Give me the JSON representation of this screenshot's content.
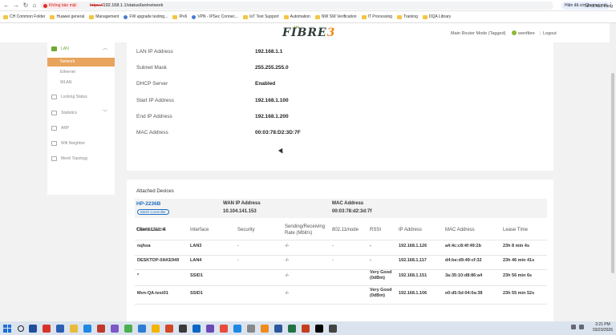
{
  "browser": {
    "security_label": "Không bảo mật",
    "url_scheme": "https://",
    "url_rest": "192.168.1.1/status/lan/network",
    "update_button": "Hiện đã có Chrome mới",
    "bookmarks": [
      {
        "label": "CH Common Folder",
        "icon": "folder"
      },
      {
        "label": "Huawei general",
        "icon": "folder"
      },
      {
        "label": "Management",
        "icon": "folder"
      },
      {
        "label": "FW upgrade testing...",
        "icon": "site"
      },
      {
        "label": "IPv6",
        "icon": "folder"
      },
      {
        "label": "VPN - IPSec Connec...",
        "icon": "site"
      },
      {
        "label": "IoT Test Support",
        "icon": "folder"
      },
      {
        "label": "Automation",
        "icon": "folder"
      },
      {
        "label": "NW SW Verification",
        "icon": "folder"
      },
      {
        "label": "IT Processing",
        "icon": "folder"
      },
      {
        "label": "Training",
        "icon": "folder"
      },
      {
        "label": "DQA Library",
        "icon": "folder"
      }
    ],
    "all_bookmarks": "Tất cả dấu trang"
  },
  "header": {
    "logo_prefix": "AIS",
    "logo_main": "FIBRE",
    "logo_digit": "3",
    "mode": "Main Router Mode (Tagged)",
    "user": "wenfibre",
    "separator": "|",
    "logout": "Logout"
  },
  "sidebar": {
    "lan": "LAN",
    "network": "Network",
    "ethernet": "Ethernet",
    "wlan": "WLAN",
    "locking": "Locking Status",
    "statistics": "Statistics",
    "arp": "ARP",
    "wifi_neighbor": "Wifi Neighbor",
    "mesh_topology": "Mesh Topology"
  },
  "lan_info": [
    {
      "label": "LAN IP Address",
      "value": "192.168.1.1"
    },
    {
      "label": "Subnet Mask",
      "value": "255.255.255.0"
    },
    {
      "label": "DHCP Server",
      "value": "Enabled"
    },
    {
      "label": "Start IP Address",
      "value": "192.168.1.100"
    },
    {
      "label": "End IP Address",
      "value": "192.168.1.200"
    },
    {
      "label": "MAC Address",
      "value": "00:03:78:D2:3D:7F"
    }
  ],
  "attached": {
    "title": "Attached Devices",
    "device_name": "HP-2236B",
    "badge": "Mesh Controller",
    "wan_label": "WAN IP Address",
    "wan_value": "10.104.141.153",
    "mac_label": "MAC Address",
    "mac_value": "00:03:78:d2:3d:7f",
    "client_list": "Client List: 4"
  },
  "table": {
    "headers": [
      "Device Name",
      "Interface",
      "Security",
      "Sending/Receiving Rate (Mbit/s)",
      "802.11mode",
      "RSSI",
      "IP Address",
      "MAC Address",
      "Lease Time"
    ],
    "rows": [
      [
        "nqhoa",
        "LAN3",
        "-",
        "-/-",
        "-",
        "-",
        "192.168.1.126",
        "a4:4c:c8:4f:49:2b",
        "23h 8 min 4s"
      ],
      [
        "DESKTOP-0AKE949",
        "LAN4",
        "-",
        "-/-",
        "-",
        "-",
        "192.168.1.117",
        "d4:be:d9:49:cf:32",
        "23h 46 min 41s"
      ],
      [
        "*",
        "SSID1",
        "",
        "-/-",
        "",
        "Very Good (0dBm)",
        "192.168.1.151",
        "3a:35:10:d8:86:a4",
        "23h 56 min 6s"
      ],
      [
        "Mvn-QA-test01",
        "SSID1",
        "",
        "-/-",
        "",
        "Very Good (0dBm)",
        "192.168.1.106",
        "e0:d5:5d:04:0a:38",
        "23h 55 min 52s"
      ]
    ]
  },
  "taskbar": {
    "time": "3:21 PM",
    "date": "03/23/2026",
    "app_colors": [
      "#1f4e9c",
      "#d7332b",
      "#2c5fb3",
      "#e8bb3b",
      "#1e88e5",
      "#c0392b",
      "#7b57c8",
      "#4caf50",
      "#2d7dd2",
      "#f4b400",
      "#d24726",
      "#3a3a3a",
      "#0a66c2",
      "#6c4ab6",
      "#e74c3c",
      "#1e88e5",
      "#888888",
      "#f08a1c",
      "#2b579a",
      "#217346",
      "#c43e1c",
      "#000000",
      "#444444"
    ]
  }
}
